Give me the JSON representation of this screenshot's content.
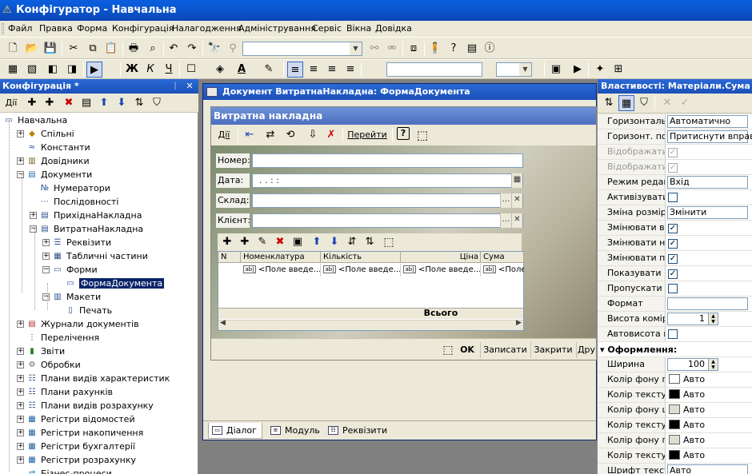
{
  "window": {
    "title": "Конфігуратор - Навчальна"
  },
  "menu": [
    "Файл",
    "Правка",
    "Форма",
    "Конфігурація",
    "Налагодження",
    "Адміністрування",
    "Сервіс",
    "Вікна",
    "Довідка"
  ],
  "left_panel": {
    "title": "Конфігурація *",
    "pin": "ᛁ",
    "close": "✕",
    "actions_label": "Дії",
    "tree": [
      {
        "label": "Навчальна",
        "level": 0,
        "icon": "config-icon"
      },
      {
        "label": "Спільні",
        "level": 1,
        "icon": "common-icon"
      },
      {
        "label": "Константи",
        "level": 1,
        "icon": "constants-icon"
      },
      {
        "label": "Довідники",
        "level": 1,
        "icon": "catalogs-icon"
      },
      {
        "label": "Документи",
        "level": 1,
        "icon": "documents-icon"
      },
      {
        "label": "Нумератори",
        "level": 2,
        "icon": "numerators-icon"
      },
      {
        "label": "Послідовності",
        "level": 2,
        "icon": "sequences-icon"
      },
      {
        "label": "ПрихіднаНакладна",
        "level": 2,
        "icon": "document-icon"
      },
      {
        "label": "ВитратнаНакладна",
        "level": 2,
        "icon": "document-icon"
      },
      {
        "label": "Реквізити",
        "level": 3,
        "icon": "attributes-icon"
      },
      {
        "label": "Табличні частини",
        "level": 3,
        "icon": "tabular-icon"
      },
      {
        "label": "Форми",
        "level": 3,
        "icon": "forms-icon"
      },
      {
        "label": "ФормаДокумента",
        "level": 4,
        "icon": "form-icon"
      },
      {
        "label": "Макети",
        "level": 3,
        "icon": "templates-icon"
      },
      {
        "label": "Печать",
        "level": 4,
        "icon": "template-icon"
      },
      {
        "label": "Журнали документів",
        "level": 1,
        "icon": "journals-icon"
      },
      {
        "label": "Перелічення",
        "level": 1,
        "icon": "enums-icon"
      },
      {
        "label": "Звіти",
        "level": 1,
        "icon": "reports-icon"
      },
      {
        "label": "Обробки",
        "level": 1,
        "icon": "processing-icon"
      },
      {
        "label": "Плани видів характеристик",
        "level": 1,
        "icon": "char-plans-icon"
      },
      {
        "label": "Плани рахунків",
        "level": 1,
        "icon": "accounts-icon"
      },
      {
        "label": "Плани видів розрахунку",
        "level": 1,
        "icon": "calc-plans-icon"
      },
      {
        "label": "Регістри відомостей",
        "level": 1,
        "icon": "info-registers-icon"
      },
      {
        "label": "Регістри накопичення",
        "level": 1,
        "icon": "accum-registers-icon"
      },
      {
        "label": "Регістри бухгалтерії",
        "level": 1,
        "icon": "acct-registers-icon"
      },
      {
        "label": "Регістри розрахунку",
        "level": 1,
        "icon": "calc-registers-icon"
      },
      {
        "label": "Бізнес-процеси",
        "level": 1,
        "icon": "bp-icon"
      }
    ]
  },
  "doc_window": {
    "title": "Документ ВитратнаНакладна: ФормаДокумента",
    "form": {
      "caption": "Витратна накладна",
      "actions_label": "Дії",
      "goto_label": "Перейти",
      "fields": [
        {
          "label": "Номер:",
          "value": ""
        },
        {
          "label": "Дата:",
          "value": ".  .       :  :"
        },
        {
          "label": "Склад:",
          "value": ""
        },
        {
          "label": "Клієнт:",
          "value": ""
        }
      ],
      "table": {
        "columns": [
          "N",
          "Номенклатура",
          "Кількість",
          "Ціна",
          "Сума"
        ],
        "placeholder": "<Поле введе...",
        "placeholder_cut": "<Поле",
        "total_label": "Всього"
      },
      "buttons": {
        "ok": "OK",
        "save": "Записати",
        "close": "Закрити",
        "more": "Дру"
      }
    },
    "tabs": [
      "Діалог",
      "Модуль",
      "Реквізити"
    ]
  },
  "properties": {
    "title": "Властивості: Матеріали.Сума",
    "rows": [
      {
        "name": "Горизонтальн",
        "kind": "text",
        "value": "Автоматично"
      },
      {
        "name": "Горизонт. пол",
        "kind": "text",
        "value": "Притиснути вправо"
      },
      {
        "name": "Відображати ш",
        "kind": "check",
        "checked": true,
        "disabled": true
      },
      {
        "name": "Відображати ш",
        "kind": "check",
        "checked": true,
        "disabled": true
      },
      {
        "name": "Режим редагу",
        "kind": "text",
        "value": "Вхід"
      },
      {
        "name": "Активізувати п",
        "kind": "check",
        "checked": false
      },
      {
        "name": "Зміна розміру",
        "kind": "text",
        "value": "Змінити"
      },
      {
        "name": "Змінювати ви",
        "kind": "check",
        "checked": true
      },
      {
        "name": "Змінювати на",
        "kind": "check",
        "checked": true
      },
      {
        "name": "Змінювати по",
        "kind": "check",
        "checked": true
      },
      {
        "name": "Показувати п",
        "kind": "check",
        "checked": true
      },
      {
        "name": "Пропускати п",
        "kind": "check",
        "checked": false
      },
      {
        "name": "Формат",
        "kind": "text",
        "value": ""
      },
      {
        "name": "Висота комірк",
        "kind": "spin",
        "value": "1"
      },
      {
        "name": "Автовисота ко",
        "kind": "check",
        "checked": false
      }
    ],
    "section": "Оформлення:",
    "rows2": [
      {
        "name": "Ширина",
        "kind": "spin",
        "value": "100"
      },
      {
        "name": "Колір фону по",
        "kind": "color",
        "value": "Авто",
        "color": "#ffffff"
      },
      {
        "name": "Колір тексту п",
        "kind": "color",
        "value": "Авто",
        "color": "#000000"
      },
      {
        "name": "Колір фону ша",
        "kind": "color",
        "value": "Авто",
        "color": "#e0ddd2"
      },
      {
        "name": "Колір тексту ш",
        "kind": "color",
        "value": "Авто",
        "color": "#000000"
      },
      {
        "name": "Колір фону під",
        "kind": "color",
        "value": "Авто",
        "color": "#e0ddd2"
      },
      {
        "name": "Колір тексту п",
        "kind": "color",
        "value": "Авто",
        "color": "#000000"
      },
      {
        "name": "Шрифт тексту",
        "kind": "text",
        "value": "Авто"
      }
    ]
  }
}
